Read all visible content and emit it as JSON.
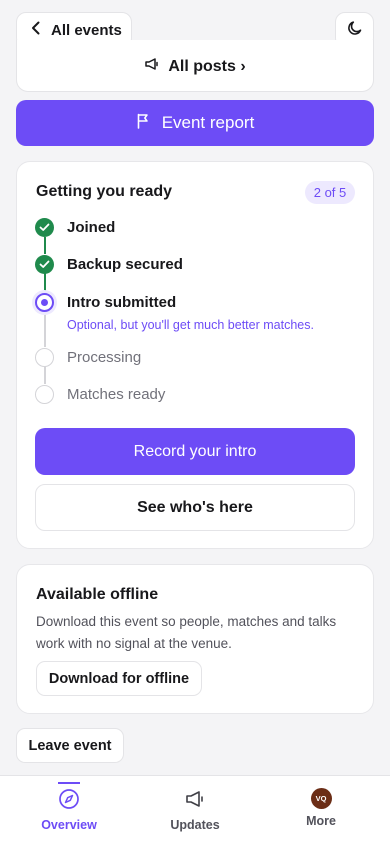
{
  "topbar": {
    "back_label": "All events"
  },
  "posts": {
    "label": "All posts ›"
  },
  "report": {
    "label": "Event report"
  },
  "ready": {
    "title": "Getting you ready",
    "badge": "2 of 5",
    "steps": [
      {
        "label": "Joined",
        "state": "done"
      },
      {
        "label": "Backup secured",
        "state": "done"
      },
      {
        "label": "Intro submitted",
        "state": "current"
      },
      {
        "label": "Processing",
        "state": "pending"
      },
      {
        "label": "Matches ready",
        "state": "pending"
      }
    ],
    "hint": "Optional, but you'll get much better matches.",
    "primary_button": "Record your intro",
    "secondary_button": "See who's here"
  },
  "offline": {
    "title": "Available offline",
    "description": "Download this event so people, matches and talks work with no signal at the venue.",
    "button": "Download for offline"
  },
  "leave_button": "Leave event",
  "tabbar": {
    "tabs": [
      {
        "label": "Overview",
        "icon": "compass-icon",
        "active": true
      },
      {
        "label": "Updates",
        "icon": "megaphone-icon",
        "active": false
      },
      {
        "label": "More",
        "icon": "avatar",
        "active": false
      }
    ],
    "avatar_initials": "VQ"
  },
  "colors": {
    "accent": "#6d4cf6",
    "success": "#1f8a4c",
    "background": "#f4f4f6"
  }
}
